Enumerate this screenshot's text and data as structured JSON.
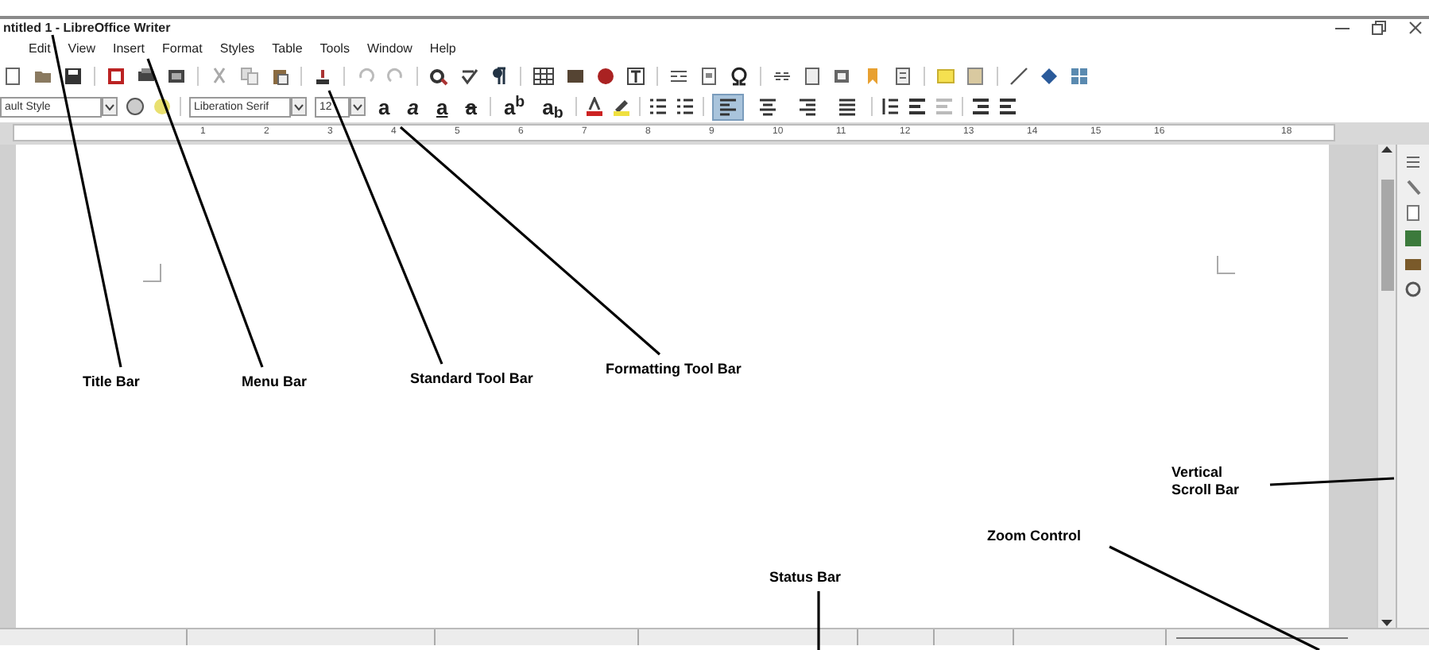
{
  "window": {
    "title": "ntitled 1 - LibreOffice Writer"
  },
  "menu": [
    "Edit",
    "View",
    "Insert",
    "Format",
    "Styles",
    "Table",
    "Tools",
    "Window",
    "Help"
  ],
  "formatting_toolbar": {
    "paragraph_style": "ault Style",
    "font_name": "Liberation Serif",
    "font_size": "12",
    "text_buttons": [
      {
        "label": "a",
        "kind": "bold"
      },
      {
        "label": "a",
        "kind": "italic"
      },
      {
        "label": "a",
        "kind": "underline"
      },
      {
        "label": "a",
        "kind": "strikethrough"
      },
      {
        "label": "a$^{b}$",
        "kind": "plain"
      },
      {
        "label": "a$_{b}$",
        "kind": "plain"
      }
    ],
    "alignment": [
      {
        "selected": true
      },
      {
        "selected": false
      },
      {
        "selected": false
      },
      {
        "selected": false
      }
    ]
  },
  "ruler": [
    "1",
    "2",
    "3",
    "4",
    "5",
    "6",
    "7",
    "8",
    "9",
    "10",
    "11",
    "12",
    "13",
    "14",
    "15",
    "16",
    "18"
  ],
  "annotations": [
    "Title Bar",
    "Menu Bar",
    "Standard Tool Bar",
    "Formatting Tool Bar",
    "Vertical Scroll Bar",
    "Zoom Control",
    "Status Bar"
  ]
}
